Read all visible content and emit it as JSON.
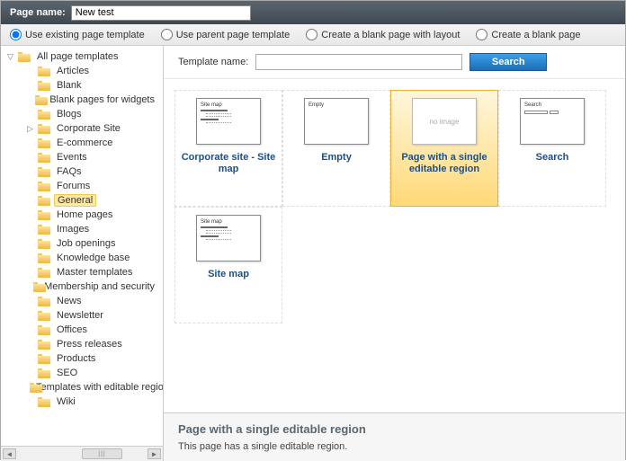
{
  "header": {
    "label": "Page name:",
    "value": "New test"
  },
  "radios": [
    {
      "label": "Use existing page template",
      "checked": true
    },
    {
      "label": "Use parent page template",
      "checked": false
    },
    {
      "label": "Create a blank page with layout",
      "checked": false
    },
    {
      "label": "Create a blank page",
      "checked": false
    }
  ],
  "tree": {
    "root": "All page templates",
    "items": [
      {
        "label": "Articles"
      },
      {
        "label": "Blank"
      },
      {
        "label": "Blank pages for widgets"
      },
      {
        "label": "Blogs"
      },
      {
        "label": "Corporate Site",
        "expandable": true
      },
      {
        "label": "E-commerce"
      },
      {
        "label": "Events"
      },
      {
        "label": "FAQs"
      },
      {
        "label": "Forums"
      },
      {
        "label": "General",
        "selected": true
      },
      {
        "label": "Home pages"
      },
      {
        "label": "Images"
      },
      {
        "label": "Job openings"
      },
      {
        "label": "Knowledge base"
      },
      {
        "label": "Master templates"
      },
      {
        "label": "Membership and security"
      },
      {
        "label": "News"
      },
      {
        "label": "Newsletter"
      },
      {
        "label": "Offices"
      },
      {
        "label": "Press releases"
      },
      {
        "label": "Products"
      },
      {
        "label": "SEO"
      },
      {
        "label": "Templates with editable regio"
      },
      {
        "label": "Wiki"
      }
    ]
  },
  "search": {
    "label": "Template name:",
    "button": "Search",
    "value": ""
  },
  "templates": [
    {
      "name": "Corporate site - Site map",
      "thumb": "sitemap"
    },
    {
      "name": "Empty",
      "thumb": "empty"
    },
    {
      "name": "Page with a single editable region",
      "thumb": "noimage",
      "selected": true
    },
    {
      "name": "Search",
      "thumb": "search"
    },
    {
      "name": "Site map",
      "thumb": "sitemap"
    }
  ],
  "details": {
    "title": "Page with a single editable region",
    "desc": "This page has a single editable region."
  }
}
